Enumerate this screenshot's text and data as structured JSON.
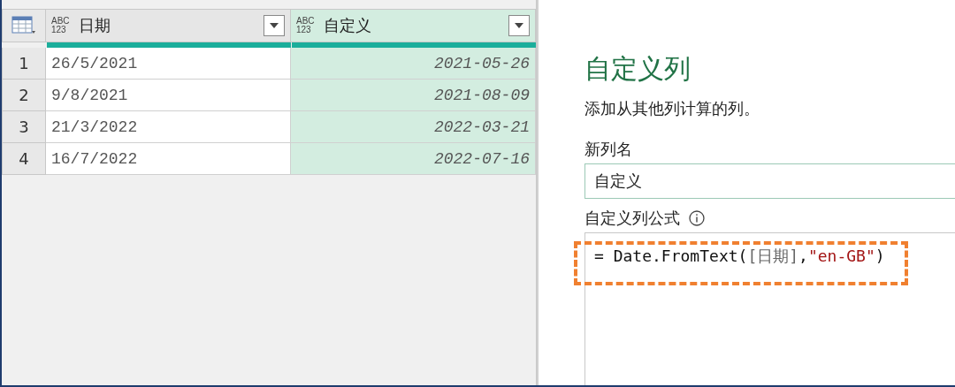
{
  "table": {
    "columns": [
      {
        "type_label": "ABC\n123",
        "name": "日期",
        "selected": false,
        "kind": "text"
      },
      {
        "type_label": "ABC\n123",
        "name": "自定义",
        "selected": true,
        "kind": "date"
      }
    ],
    "rows": [
      {
        "number": "1",
        "cells": [
          "26/5/2021",
          "2021-05-26"
        ]
      },
      {
        "number": "2",
        "cells": [
          "9/8/2021",
          "2021-08-09"
        ]
      },
      {
        "number": "3",
        "cells": [
          "21/3/2022",
          "2022-03-21"
        ]
      },
      {
        "number": "4",
        "cells": [
          "16/7/2022",
          "2022-07-16"
        ]
      }
    ]
  },
  "dialog": {
    "title": "自定义列",
    "subtitle": "添加从其他列计算的列。",
    "name_label": "新列名",
    "name_value": "自定义",
    "formula_label": "自定义列公式",
    "formula": [
      {
        "kind": "code",
        "text": "= Date.FromText("
      },
      {
        "kind": "column",
        "text": "[日期]"
      },
      {
        "kind": "code",
        "text": ","
      },
      {
        "kind": "string",
        "text": "\"en-GB\""
      },
      {
        "kind": "code",
        "text": ")"
      }
    ],
    "formula_highlighted": true
  }
}
